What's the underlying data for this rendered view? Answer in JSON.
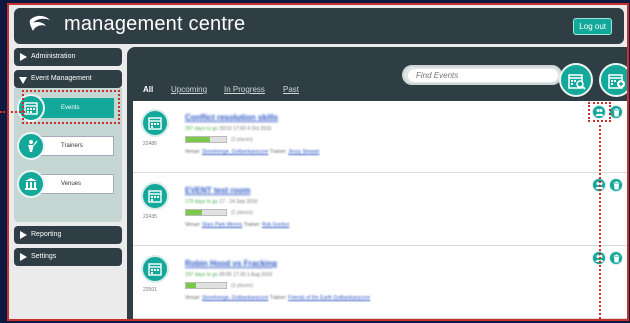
{
  "header": {
    "brand": "management centre",
    "logout_label": "Log out"
  },
  "sidebar": {
    "administration": "Administration",
    "event_management": "Event Management",
    "sub_items": [
      {
        "label": "Events",
        "icon": "calendar-icon",
        "active": true
      },
      {
        "label": "Trainers",
        "icon": "trainer-icon",
        "active": false
      },
      {
        "label": "Venues",
        "icon": "venue-icon",
        "active": false
      }
    ],
    "reporting": "Reporting",
    "settings": "Settings"
  },
  "main": {
    "search": {
      "placeholder": "Find Events"
    },
    "tabs": [
      {
        "label": "All",
        "active": true
      },
      {
        "label": "Upcoming",
        "active": false
      },
      {
        "label": "In Progress",
        "active": false
      },
      {
        "label": "Past",
        "active": false
      }
    ],
    "events": [
      {
        "id": "22486",
        "title": "Conflict resolution skills",
        "sub_green": "297 days to go",
        "sub_rest": "20/10 17:00 4 Oct 2016",
        "progress_pct": 60,
        "progress_text": "(3 places)",
        "meta_label": "Venue:",
        "meta_venue": "Stonehenge, Gotbankanscore",
        "meta_trainer_label": "Trainer:",
        "meta_trainer": "Jessy Stewart"
      },
      {
        "id": "22435",
        "title": "EVENT test room",
        "sub_green": "179 days to go",
        "sub_rest": "17 - 14 Sep 2016",
        "progress_pct": 40,
        "progress_text": "(2 places)",
        "meta_label": "Venue:",
        "meta_venue": "Stars Park Mirrors",
        "meta_trainer_label": "Trainer:",
        "meta_trainer": "Rob Gordon"
      },
      {
        "id": "22501",
        "title": "Robin Hood vs Fracking",
        "sub_green": "197 days to go",
        "sub_rest": "09:00 17:30 1 Aug 2016",
        "progress_pct": 25,
        "progress_text": "(3 places)",
        "meta_label": "Venue:",
        "meta_venue": "Stonehenge, Gotbankanscore",
        "meta_trainer_label": "Trainer:",
        "meta_trainer": "Friends of the Earth Gotbankanscore"
      }
    ]
  },
  "colors": {
    "accent": "#14a89a",
    "dark": "#2f3d44",
    "highlight": "#c8302c",
    "link": "#2b56c5"
  }
}
